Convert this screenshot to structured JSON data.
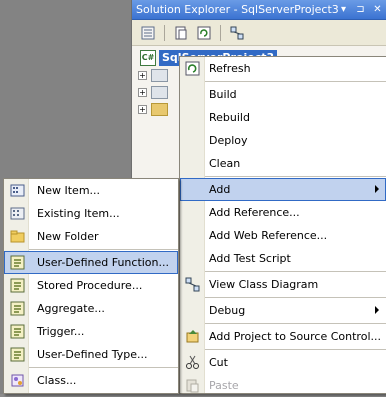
{
  "panel": {
    "title": "Solution Explorer - SqlServerProject3",
    "pin_glyph": "▾",
    "autohide_glyph": "⊐",
    "close_glyph": "✕"
  },
  "toolbar": {
    "icons": [
      "properties-icon",
      "show-all-files-icon",
      "refresh-icon",
      "view-class-diagram-icon"
    ]
  },
  "tree": {
    "root_label": "SqlServerProject3",
    "children": [
      {
        "icon": "properties-folder-icon",
        "expander": "+"
      },
      {
        "icon": "references-icon",
        "expander": "+"
      },
      {
        "icon": "folder-icon",
        "expander": "+"
      }
    ]
  },
  "context_menu": {
    "items": [
      {
        "label": "Refresh",
        "icon": "refresh-icon"
      },
      {
        "label": "Build",
        "icon": ""
      },
      {
        "label": "Rebuild",
        "icon": ""
      },
      {
        "label": "Deploy",
        "icon": ""
      },
      {
        "label": "Clean",
        "icon": ""
      },
      {
        "label": "Add",
        "icon": "",
        "submenu": true,
        "highlighted": true
      },
      {
        "label": "Add Reference...",
        "icon": ""
      },
      {
        "label": "Add Web Reference...",
        "icon": ""
      },
      {
        "label": "Add Test Script",
        "icon": ""
      },
      {
        "label": "View Class Diagram",
        "icon": "class-diagram-icon"
      },
      {
        "label": "Debug",
        "icon": "",
        "submenu": true
      },
      {
        "label": "Add Project to Source Control...",
        "icon": "source-control-icon"
      },
      {
        "label": "Cut",
        "icon": "scissors-icon"
      },
      {
        "label": "Paste",
        "icon": "paste-icon",
        "disabled": true
      }
    ]
  },
  "add_submenu": {
    "items": [
      {
        "label": "New Item...",
        "icon": "new-item-icon"
      },
      {
        "label": "Existing Item...",
        "icon": "existing-item-icon"
      },
      {
        "label": "New Folder",
        "icon": "new-folder-icon"
      },
      {
        "label": "User-Defined Function...",
        "icon": "user-defined-function-icon",
        "highlighted": true
      },
      {
        "label": "Stored Procedure...",
        "icon": "stored-procedure-icon"
      },
      {
        "label": "Aggregate...",
        "icon": "aggregate-icon"
      },
      {
        "label": "Trigger...",
        "icon": "trigger-icon"
      },
      {
        "label": "User-Defined Type...",
        "icon": "user-defined-type-icon"
      },
      {
        "label": "Class...",
        "icon": "class-icon"
      }
    ]
  },
  "colors": {
    "title_bar": "#3b73d1",
    "selection": "#316ac5",
    "menu_highlight": "#c1d2ee",
    "menu_gutter": "#f0efe6"
  }
}
